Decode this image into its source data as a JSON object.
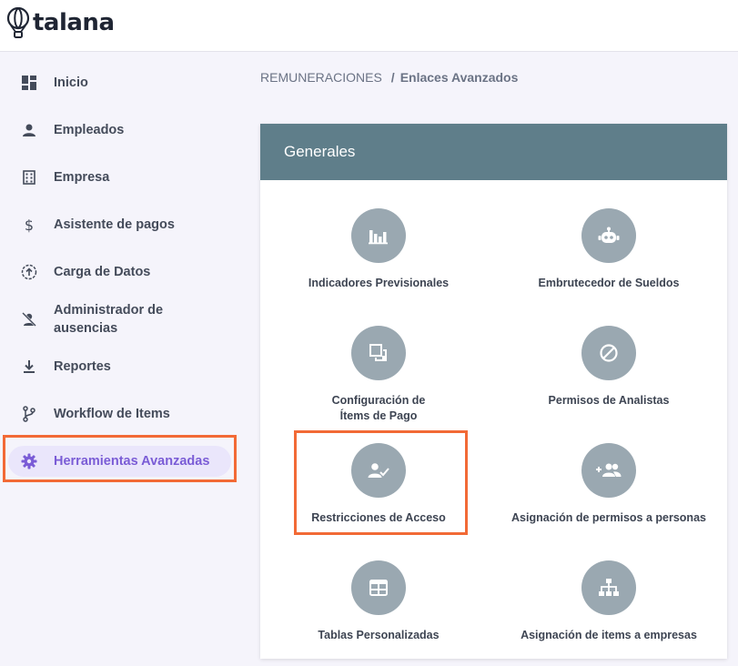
{
  "brand": {
    "name": "talana"
  },
  "sidebar": {
    "items": [
      {
        "label": "Inicio",
        "icon": "dashboard-icon"
      },
      {
        "label": "Empleados",
        "icon": "person-icon"
      },
      {
        "label": "Empresa",
        "icon": "building-icon"
      },
      {
        "label": "Asistente de pagos",
        "icon": "dollar-icon"
      },
      {
        "label": "Carga de Datos",
        "icon": "upload-icon"
      },
      {
        "label": "Administrador de ausencias",
        "icon": "person-off-icon"
      },
      {
        "label": "Reportes",
        "icon": "download-icon"
      },
      {
        "label": "Workflow de Items",
        "icon": "workflow-icon"
      },
      {
        "label": "Herramientas Avanzadas",
        "icon": "gear-icon",
        "active": true
      }
    ]
  },
  "breadcrumb": {
    "parent": "REMUNERACIONES",
    "separator": "/",
    "current": "Enlaces Avanzados"
  },
  "card": {
    "title": "Generales",
    "tools": [
      {
        "label": "Indicadores Previsionales",
        "icon": "bar-chart-icon"
      },
      {
        "label": "Embrutecedor de Sueldos",
        "icon": "robot-icon"
      },
      {
        "label": "Configuración de Ítems de Pago",
        "icon": "copy-icon"
      },
      {
        "label": "Permisos de Analistas",
        "icon": "block-icon"
      },
      {
        "label": "Restricciones de Acceso",
        "icon": "person-check-icon",
        "highlighted": true
      },
      {
        "label": "Asignación de permisos a personas",
        "icon": "group-add-icon"
      },
      {
        "label": "Tablas Personalizadas",
        "icon": "table-icon"
      },
      {
        "label": "Asignación de items a empresas",
        "icon": "hierarchy-icon"
      }
    ]
  },
  "colors": {
    "accent": "#7a5cd6",
    "header": "#5f7e8a",
    "icon_circle": "#9aa8b1",
    "highlight": "#f26a36"
  }
}
